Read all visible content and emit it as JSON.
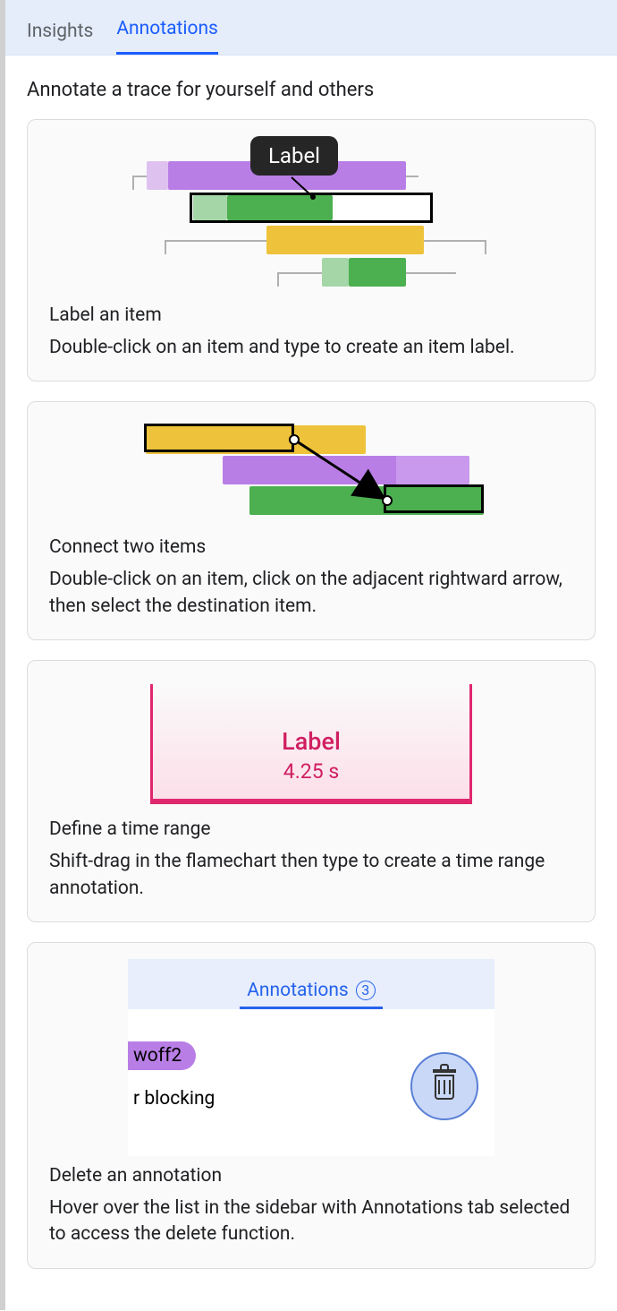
{
  "tabs": {
    "insights": "Insights",
    "annotations": "Annotations"
  },
  "heading": "Annotate a trace for yourself and others",
  "card1": {
    "label_pill": "Label",
    "title": "Label an item",
    "text": "Double-click on an item and type to create an item label."
  },
  "card2": {
    "title": "Connect two items",
    "text": "Double-click on an item, click on the adjacent rightward arrow, then select the destination item."
  },
  "card3": {
    "range_label": "Label",
    "range_time": "4.25 s",
    "title": "Define a time range",
    "text": "Shift-drag in the flamechart then type to create a time range annotation."
  },
  "card4": {
    "mini_tab_label": "Annotations",
    "mini_tab_count": "3",
    "row1": "woff2",
    "row2": "r blocking",
    "title": "Delete an annotation",
    "text": "Hover over the list in the sidebar with Annotations tab selected to access the delete function."
  }
}
